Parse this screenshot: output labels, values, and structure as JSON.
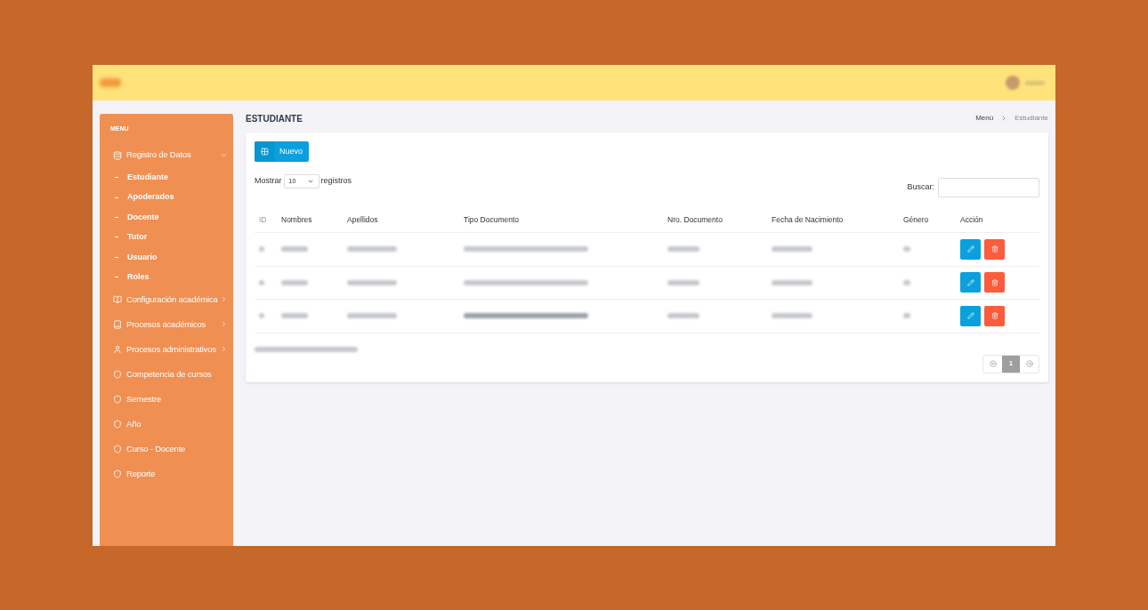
{
  "topbar": {
    "logo_redacted": true,
    "user_redacted": true
  },
  "sidebar": {
    "heading": "MENU",
    "items": [
      {
        "label": "Registro de Datos",
        "kind": "group",
        "expanded": true,
        "children": [
          {
            "label": "Estudiante"
          },
          {
            "label": "Apoderados"
          },
          {
            "label": "Docente"
          },
          {
            "label": "Tutor"
          },
          {
            "label": "Usuario"
          },
          {
            "label": "Roles"
          }
        ]
      },
      {
        "label": "Configuración académica",
        "kind": "group",
        "expanded": false
      },
      {
        "label": "Procesos académicos",
        "kind": "group",
        "expanded": false
      },
      {
        "label": "Procesos administrativos",
        "kind": "group",
        "expanded": false
      },
      {
        "label": "Competencia de cursos",
        "kind": "link"
      },
      {
        "label": "Semestre",
        "kind": "link"
      },
      {
        "label": "Año",
        "kind": "link"
      },
      {
        "label": "Curso - Docente",
        "kind": "link"
      },
      {
        "label": "Reporte",
        "kind": "link"
      }
    ]
  },
  "page_title": "ESTUDIANTE",
  "breadcrumb": [
    "Menú",
    "Estudiante"
  ],
  "new_button": "Nuevo",
  "length_control": {
    "before": "Mostrar",
    "value": "10",
    "after": "registros"
  },
  "search": {
    "label": "Buscar:"
  },
  "table": {
    "columns": [
      "ID",
      "Nombres",
      "Apellidos",
      "Tipo Documento",
      "Nro. Documento",
      "Fecha de Nacimiento",
      "Género",
      "Acción"
    ],
    "rows": [
      {
        "redacted": true
      },
      {
        "redacted": true
      },
      {
        "redacted": true
      }
    ]
  },
  "info_redacted": true,
  "pagination": {
    "pages": [
      {
        "label": "1",
        "selected": true
      }
    ]
  }
}
